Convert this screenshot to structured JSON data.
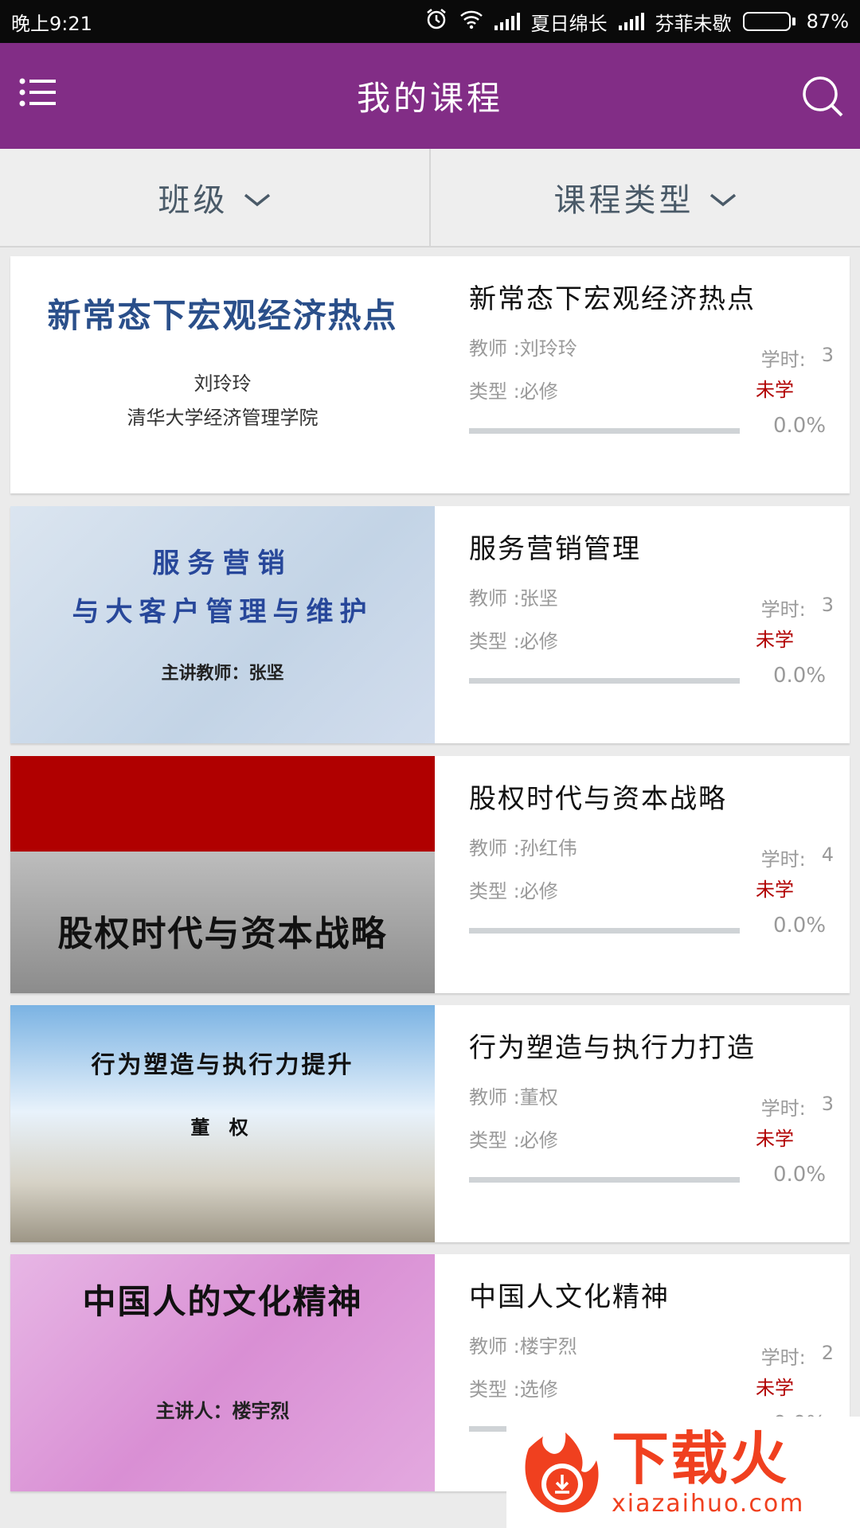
{
  "status_bar": {
    "time": "晚上9:21",
    "carrier1": "夏日绵长",
    "carrier2": "芬菲未歇",
    "battery": "87%",
    "battery_level": 87
  },
  "header": {
    "title": "我的课程",
    "menu_icon": "list-menu-icon",
    "search_icon": "search-icon"
  },
  "filters": [
    {
      "label": "班级"
    },
    {
      "label": "课程类型"
    }
  ],
  "labels": {
    "hours_label": "学时:"
  },
  "courses": [
    {
      "title": "新常态下宏观经济热点",
      "teacher": "教师 :刘玲玲",
      "type": "类型 :必修",
      "hours": "3",
      "status": "未学",
      "progress_text": "0.0%",
      "progress": 0,
      "thumb": {
        "line1": "新常态下宏观经济热点",
        "line2": "刘玲玲",
        "line3": "清华大学经济管理学院"
      }
    },
    {
      "title": "服务营销管理",
      "teacher": "教师 :张坚",
      "type": "类型 :必修",
      "hours": "3",
      "status": "未学",
      "progress_text": "0.0%",
      "progress": 0,
      "thumb": {
        "line1": "服务营销",
        "line2": "与大客户管理与维护",
        "line3": "主讲教师：张坚"
      }
    },
    {
      "title": "股权时代与资本战略",
      "teacher": "教师 :孙红伟",
      "type": "类型 :必修",
      "hours": "4",
      "status": "未学",
      "progress_text": "0.0%",
      "progress": 0,
      "thumb": {
        "line1": "股权时代与资本战略"
      }
    },
    {
      "title": "行为塑造与执行力打造",
      "teacher": "教师 :董权",
      "type": "类型 :必修",
      "hours": "3",
      "status": "未学",
      "progress_text": "0.0%",
      "progress": 0,
      "thumb": {
        "line1": "行为塑造与执行力提升",
        "line2": "董 权"
      }
    },
    {
      "title": "中国人文化精神",
      "teacher": "教师 :楼宇烈",
      "type": "类型 :选修",
      "hours": "2",
      "status": "未学",
      "progress_text": "0.0%",
      "progress": 0,
      "thumb": {
        "line1": "中国人的文化精神",
        "line2": "主讲人：楼宇烈"
      }
    }
  ],
  "watermark": {
    "brand": "下载火",
    "url": "xiazaihuo.com"
  },
  "colors": {
    "primary": "#822d86",
    "status_red": "#b10000",
    "muted_text": "#9a9a9a",
    "filter_text": "#4a5a68"
  }
}
